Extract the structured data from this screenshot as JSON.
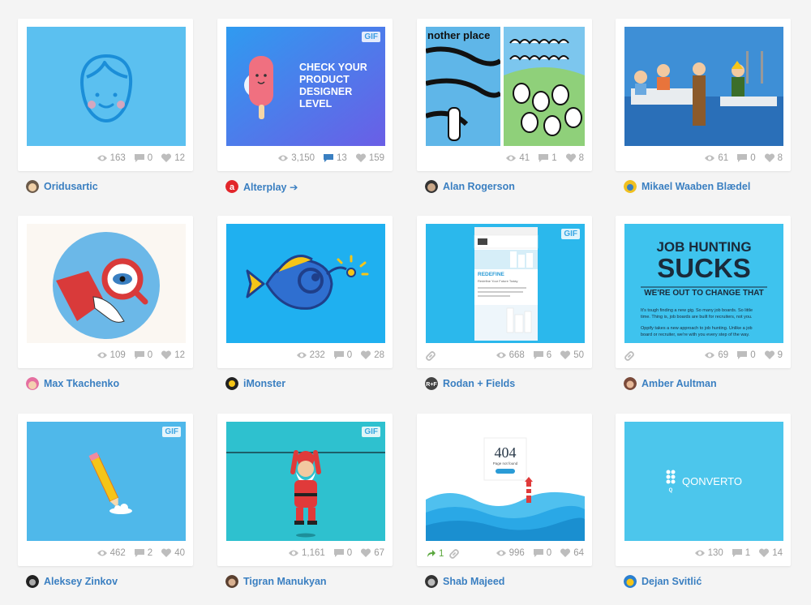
{
  "shots": [
    {
      "author": "Oridusartic",
      "views": "163",
      "comments": "0",
      "likes": "12"
    },
    {
      "author": "Alterplay ➔",
      "views": "3,150",
      "comments": "13",
      "likes": "159",
      "badge": "GIF",
      "thumb_text": [
        "CHECK YOUR",
        "PRODUCT",
        "DESIGNER",
        "LEVEL"
      ]
    },
    {
      "author": "Alan Rogerson",
      "views": "41",
      "comments": "1",
      "likes": "8",
      "thumb_text": [
        "nother place"
      ]
    },
    {
      "author": "Mikael Waaben Blædel",
      "views": "61",
      "comments": "0",
      "likes": "8"
    },
    {
      "author": "Max Tkachenko",
      "views": "109",
      "comments": "0",
      "likes": "12"
    },
    {
      "author": "iMonster",
      "views": "232",
      "comments": "0",
      "likes": "28"
    },
    {
      "author": "Rodan + Fields",
      "views": "668",
      "comments": "6",
      "likes": "50",
      "badge": "GIF",
      "thumb_text": [
        "REDEFINE",
        "Redefine Your Future Today"
      ]
    },
    {
      "author": "Amber Aultman",
      "views": "69",
      "comments": "0",
      "likes": "9",
      "thumb_text": [
        "JOB HUNTING",
        "SUCKS",
        "WE'RE OUT TO CHANGE THAT",
        "It's tough finding a new gig. So many job boards. So little",
        "time. Thing is, job boards are built for recruiters, not you.",
        "Oppify takes a new approach to job hunting. Unlike a job",
        "board or recruiter, we're with you every step of the way."
      ]
    },
    {
      "author": "Aleksey Zinkov",
      "views": "462",
      "comments": "2",
      "likes": "40",
      "badge": "GIF"
    },
    {
      "author": "Tigran Manukyan",
      "views": "1,161",
      "comments": "0",
      "likes": "67",
      "badge": "GIF"
    },
    {
      "author": "Shab Majeed",
      "views": "996",
      "comments": "0",
      "likes": "64",
      "rebounds": "1",
      "thumb_text": [
        "404",
        "Page not found"
      ]
    },
    {
      "author": "Dejan Svitlić",
      "views": "130",
      "comments": "1",
      "likes": "14",
      "thumb_text": [
        "QONVERTO"
      ]
    }
  ],
  "colors": {
    "link": "#3a7fc1",
    "stat": "#9a9a9a",
    "comment_active": "#3a7fc1",
    "rebound": "#5aa73d"
  }
}
